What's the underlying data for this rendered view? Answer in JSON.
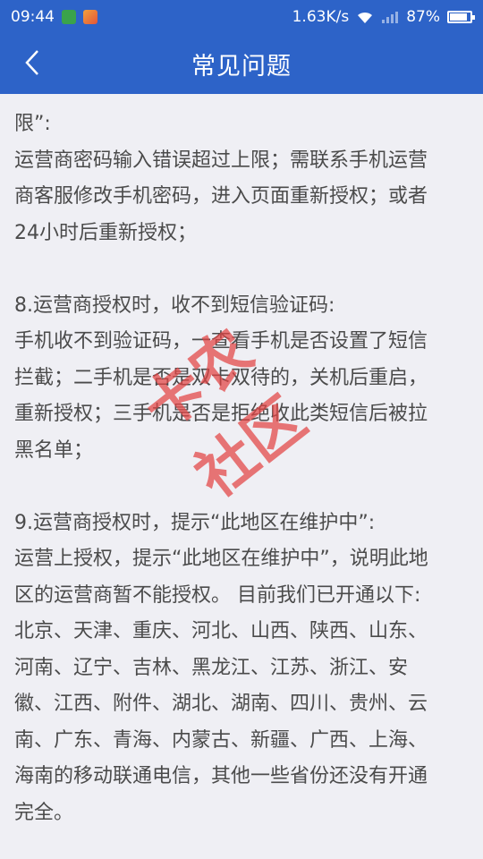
{
  "status_bar": {
    "time": "09:44",
    "network_speed": "1.63K/s",
    "battery_percent": "87%",
    "battery_level": 0.87
  },
  "header": {
    "title": "常见问题",
    "back_icon": "chevron-left-icon"
  },
  "content": {
    "lines": [
      "限”:",
      "运营商密码输入错误超过上限；需联系手机运营",
      "商客服修改手机密码，进入页面重新授权；或者",
      "24小时后重新授权；",
      "",
      "8.运营商授权时，收不到短信验证码:",
      "手机收不到验证码，一查看手机是否设置了短信",
      "拦截；二手机是否是双卡双待的，关机后重启，",
      "重新授权；三手机是否是拒绝收此类短信后被拉",
      "黑名单；",
      "",
      "9.运营商授权时，提示“此地区在维护中”:",
      "运营上授权，提示“此地区在维护中”，说明此地",
      "区的运营商暂不能授权。 目前我们已开通以下:",
      "北京、天津、重庆、河北、山西、陕西、山东、",
      "河南、辽宁、吉林、黑龙江、江苏、浙江、安",
      "徽、江西、附件、湖北、湖南、四川、贵州、云",
      "南、广东、青海、内蒙古、新疆、广西、上海、",
      "海南的移动联通电信，其他一些省份还没有开通",
      "完全。"
    ]
  },
  "watermark": {
    "text": "卡农社区",
    "color": "#e24242"
  },
  "colors": {
    "brand": "#2d63c8",
    "background": "#efeff4",
    "text": "#4b4b4b"
  }
}
